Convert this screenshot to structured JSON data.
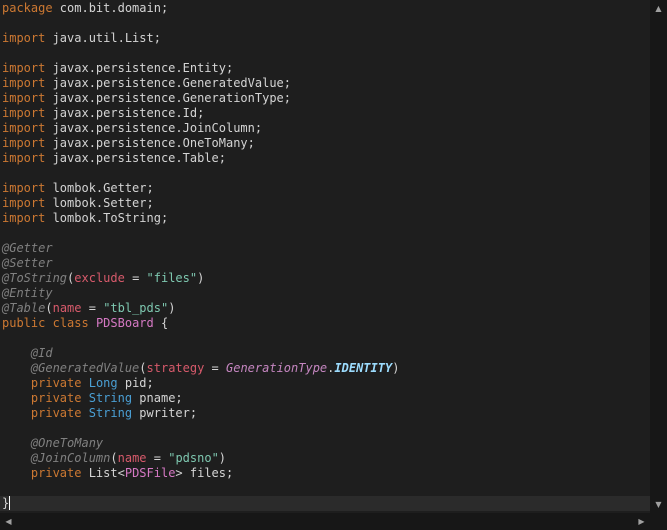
{
  "colors": {
    "background": "#1e1e1e",
    "plain": "#d4d4d4",
    "keyword": "#cc7832",
    "annotation": "#808080",
    "param": "#d75a6b",
    "string": "#7ec8b0",
    "type": "#4a9fd4",
    "class_decl": "#d679c4",
    "generic": "#c586c0",
    "constant": "#9cdcfe"
  },
  "icons": {
    "scroll_up": "▲",
    "scroll_down": "▼",
    "scroll_left": "◀",
    "scroll_right": "▶"
  },
  "code_lines": [
    [
      {
        "t": "package",
        "c": "keyword"
      },
      {
        "t": " com.bit.domain;",
        "c": "plain"
      }
    ],
    [],
    [
      {
        "t": "import",
        "c": "keyword"
      },
      {
        "t": " java.util.List;",
        "c": "plain"
      }
    ],
    [],
    [
      {
        "t": "import",
        "c": "keyword"
      },
      {
        "t": " javax.persistence.Entity;",
        "c": "plain"
      }
    ],
    [
      {
        "t": "import",
        "c": "keyword"
      },
      {
        "t": " javax.persistence.GeneratedValue;",
        "c": "plain"
      }
    ],
    [
      {
        "t": "import",
        "c": "keyword"
      },
      {
        "t": " javax.persistence.GenerationType;",
        "c": "plain"
      }
    ],
    [
      {
        "t": "import",
        "c": "keyword"
      },
      {
        "t": " javax.persistence.Id;",
        "c": "plain"
      }
    ],
    [
      {
        "t": "import",
        "c": "keyword"
      },
      {
        "t": " javax.persistence.JoinColumn;",
        "c": "plain"
      }
    ],
    [
      {
        "t": "import",
        "c": "keyword"
      },
      {
        "t": " javax.persistence.OneToMany;",
        "c": "plain"
      }
    ],
    [
      {
        "t": "import",
        "c": "keyword"
      },
      {
        "t": " javax.persistence.Table;",
        "c": "plain"
      }
    ],
    [],
    [
      {
        "t": "import",
        "c": "keyword"
      },
      {
        "t": " lombok.Getter;",
        "c": "plain"
      }
    ],
    [
      {
        "t": "import",
        "c": "keyword"
      },
      {
        "t": " lombok.Setter;",
        "c": "plain"
      }
    ],
    [
      {
        "t": "import",
        "c": "keyword"
      },
      {
        "t": " lombok.ToString;",
        "c": "plain"
      }
    ],
    [],
    [
      {
        "t": "@Getter",
        "c": "annotation"
      }
    ],
    [
      {
        "t": "@Setter",
        "c": "annotation"
      }
    ],
    [
      {
        "t": "@ToString",
        "c": "annotation"
      },
      {
        "t": "(",
        "c": "plain"
      },
      {
        "t": "exclude",
        "c": "param"
      },
      {
        "t": " = ",
        "c": "plain"
      },
      {
        "t": "\"files\"",
        "c": "string"
      },
      {
        "t": ")",
        "c": "plain"
      }
    ],
    [
      {
        "t": "@Entity",
        "c": "annotation"
      }
    ],
    [
      {
        "t": "@Table",
        "c": "annotation"
      },
      {
        "t": "(",
        "c": "plain"
      },
      {
        "t": "name",
        "c": "param"
      },
      {
        "t": " = ",
        "c": "plain"
      },
      {
        "t": "\"tbl_pds\"",
        "c": "string"
      },
      {
        "t": ")",
        "c": "plain"
      }
    ],
    [
      {
        "t": "public",
        "c": "keyword"
      },
      {
        "t": " ",
        "c": "plain"
      },
      {
        "t": "class",
        "c": "keyword"
      },
      {
        "t": " ",
        "c": "plain"
      },
      {
        "t": "PDSBoard",
        "c": "class_decl"
      },
      {
        "t": " {",
        "c": "plain"
      }
    ],
    [],
    [
      {
        "t": "    ",
        "c": "plain"
      },
      {
        "t": "@Id",
        "c": "annotation"
      }
    ],
    [
      {
        "t": "    ",
        "c": "plain"
      },
      {
        "t": "@GeneratedValue",
        "c": "annotation"
      },
      {
        "t": "(",
        "c": "plain"
      },
      {
        "t": "strategy",
        "c": "param"
      },
      {
        "t": " = ",
        "c": "plain"
      },
      {
        "t": "GenerationType",
        "c": "generic"
      },
      {
        "t": ".",
        "c": "plain"
      },
      {
        "t": "IDENTITY",
        "c": "constant"
      },
      {
        "t": ")",
        "c": "plain"
      }
    ],
    [
      {
        "t": "    ",
        "c": "plain"
      },
      {
        "t": "private",
        "c": "keyword"
      },
      {
        "t": " ",
        "c": "plain"
      },
      {
        "t": "Long",
        "c": "type"
      },
      {
        "t": " pid;",
        "c": "plain"
      }
    ],
    [
      {
        "t": "    ",
        "c": "plain"
      },
      {
        "t": "private",
        "c": "keyword"
      },
      {
        "t": " ",
        "c": "plain"
      },
      {
        "t": "String",
        "c": "type"
      },
      {
        "t": " pname;",
        "c": "plain"
      }
    ],
    [
      {
        "t": "    ",
        "c": "plain"
      },
      {
        "t": "private",
        "c": "keyword"
      },
      {
        "t": " ",
        "c": "plain"
      },
      {
        "t": "String",
        "c": "type"
      },
      {
        "t": " pwriter;",
        "c": "plain"
      }
    ],
    [],
    [
      {
        "t": "    ",
        "c": "plain"
      },
      {
        "t": "@OneToMany",
        "c": "annotation"
      }
    ],
    [
      {
        "t": "    ",
        "c": "plain"
      },
      {
        "t": "@JoinColumn",
        "c": "annotation"
      },
      {
        "t": "(",
        "c": "plain"
      },
      {
        "t": "name",
        "c": "param"
      },
      {
        "t": " = ",
        "c": "plain"
      },
      {
        "t": "\"pdsno\"",
        "c": "string"
      },
      {
        "t": ")",
        "c": "plain"
      }
    ],
    [
      {
        "t": "    ",
        "c": "plain"
      },
      {
        "t": "private",
        "c": "keyword"
      },
      {
        "t": " List<",
        "c": "plain"
      },
      {
        "t": "PDSFile",
        "c": "class_decl"
      },
      {
        "t": "> files;",
        "c": "plain"
      }
    ],
    [],
    [
      {
        "t": "}",
        "c": "plain"
      }
    ],
    []
  ],
  "cursor_line": 33
}
